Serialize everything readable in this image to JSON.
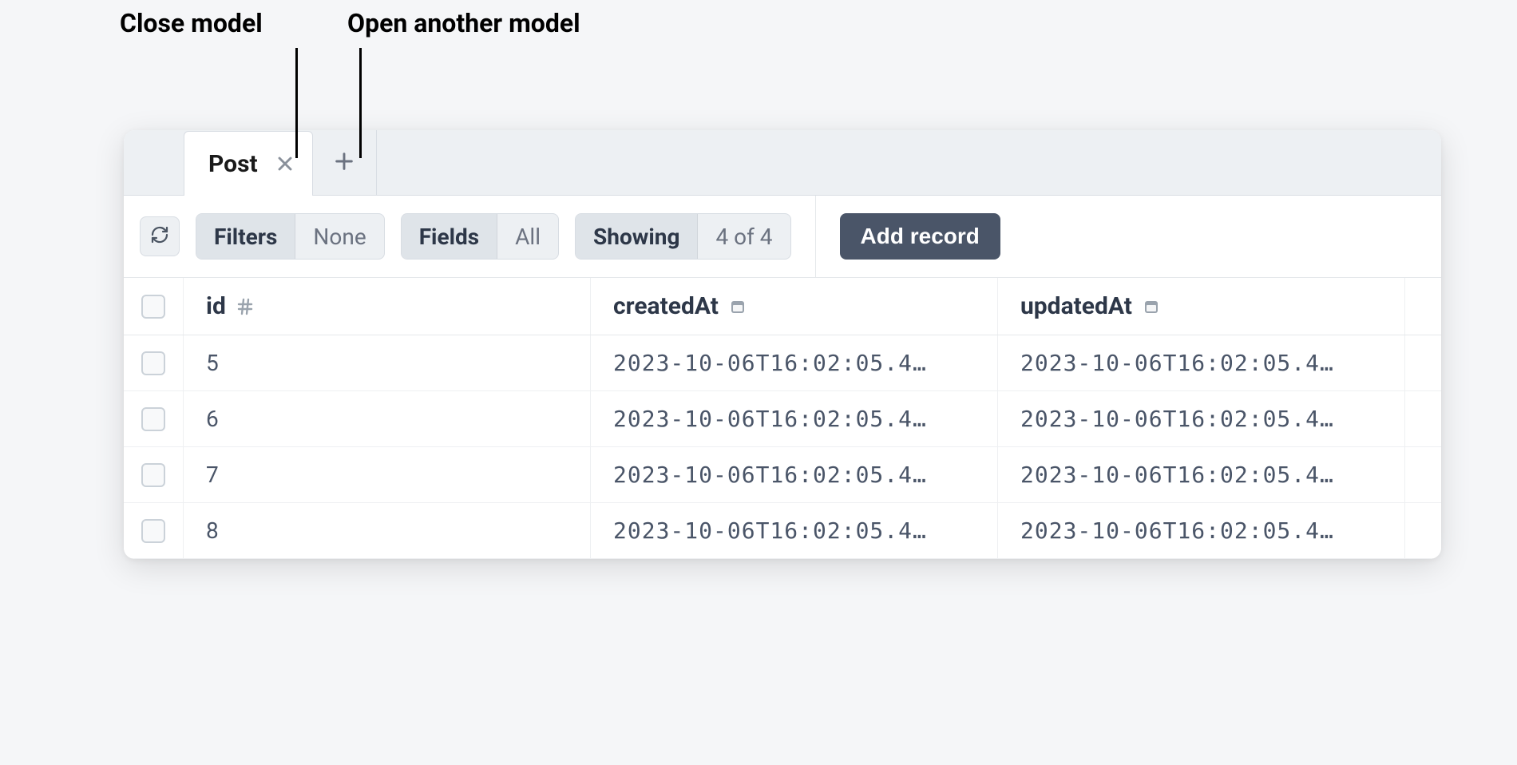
{
  "annotations": {
    "close_label": "Close model",
    "open_label": "Open another model"
  },
  "tabs": {
    "active": {
      "label": "Post"
    }
  },
  "toolbar": {
    "filters": {
      "label": "Filters",
      "value": "None"
    },
    "fields": {
      "label": "Fields",
      "value": "All"
    },
    "showing": {
      "label": "Showing",
      "value": "4 of 4"
    },
    "add_record_label": "Add record"
  },
  "table": {
    "columns": {
      "id": "id",
      "createdAt": "createdAt",
      "updatedAt": "updatedAt"
    },
    "rows": [
      {
        "id": "5",
        "createdAt": "2023-10-06T16:02:05.4…",
        "updatedAt": "2023-10-06T16:02:05.4…"
      },
      {
        "id": "6",
        "createdAt": "2023-10-06T16:02:05.4…",
        "updatedAt": "2023-10-06T16:02:05.4…"
      },
      {
        "id": "7",
        "createdAt": "2023-10-06T16:02:05.4…",
        "updatedAt": "2023-10-06T16:02:05.4…"
      },
      {
        "id": "8",
        "createdAt": "2023-10-06T16:02:05.4…",
        "updatedAt": "2023-10-06T16:02:05.4…"
      }
    ]
  }
}
